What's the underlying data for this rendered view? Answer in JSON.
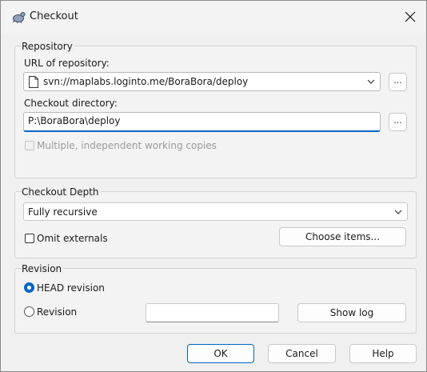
{
  "window": {
    "title": "Checkout"
  },
  "repository": {
    "group_label": "Repository",
    "url_label": "URL of repository:",
    "url_value": "svn://maplabs.loginto.me/BoraBora/deploy",
    "browse_label": "...",
    "dir_label": "Checkout directory:",
    "dir_value": "P:\\BoraBora\\deploy",
    "dir_browse_label": "...",
    "multi_label": "Multiple, independent working copies",
    "multi_checked": false
  },
  "depth": {
    "group_label": "Checkout Depth",
    "selected": "Fully recursive",
    "omit_label": "Omit externals",
    "omit_checked": false,
    "choose_items_label": "Choose items..."
  },
  "revision": {
    "group_label": "Revision",
    "head_label": "HEAD revision",
    "head_selected": true,
    "rev_label": "Revision",
    "rev_value": "",
    "show_log_label": "Show log"
  },
  "buttons": {
    "ok": "OK",
    "cancel": "Cancel",
    "help": "Help"
  },
  "colors": {
    "accent": "#0067c0"
  },
  "icons": {
    "app": "tortoise-svn-icon",
    "close": "close-icon",
    "file": "file-icon",
    "dropdown": "chevron-down-icon"
  }
}
